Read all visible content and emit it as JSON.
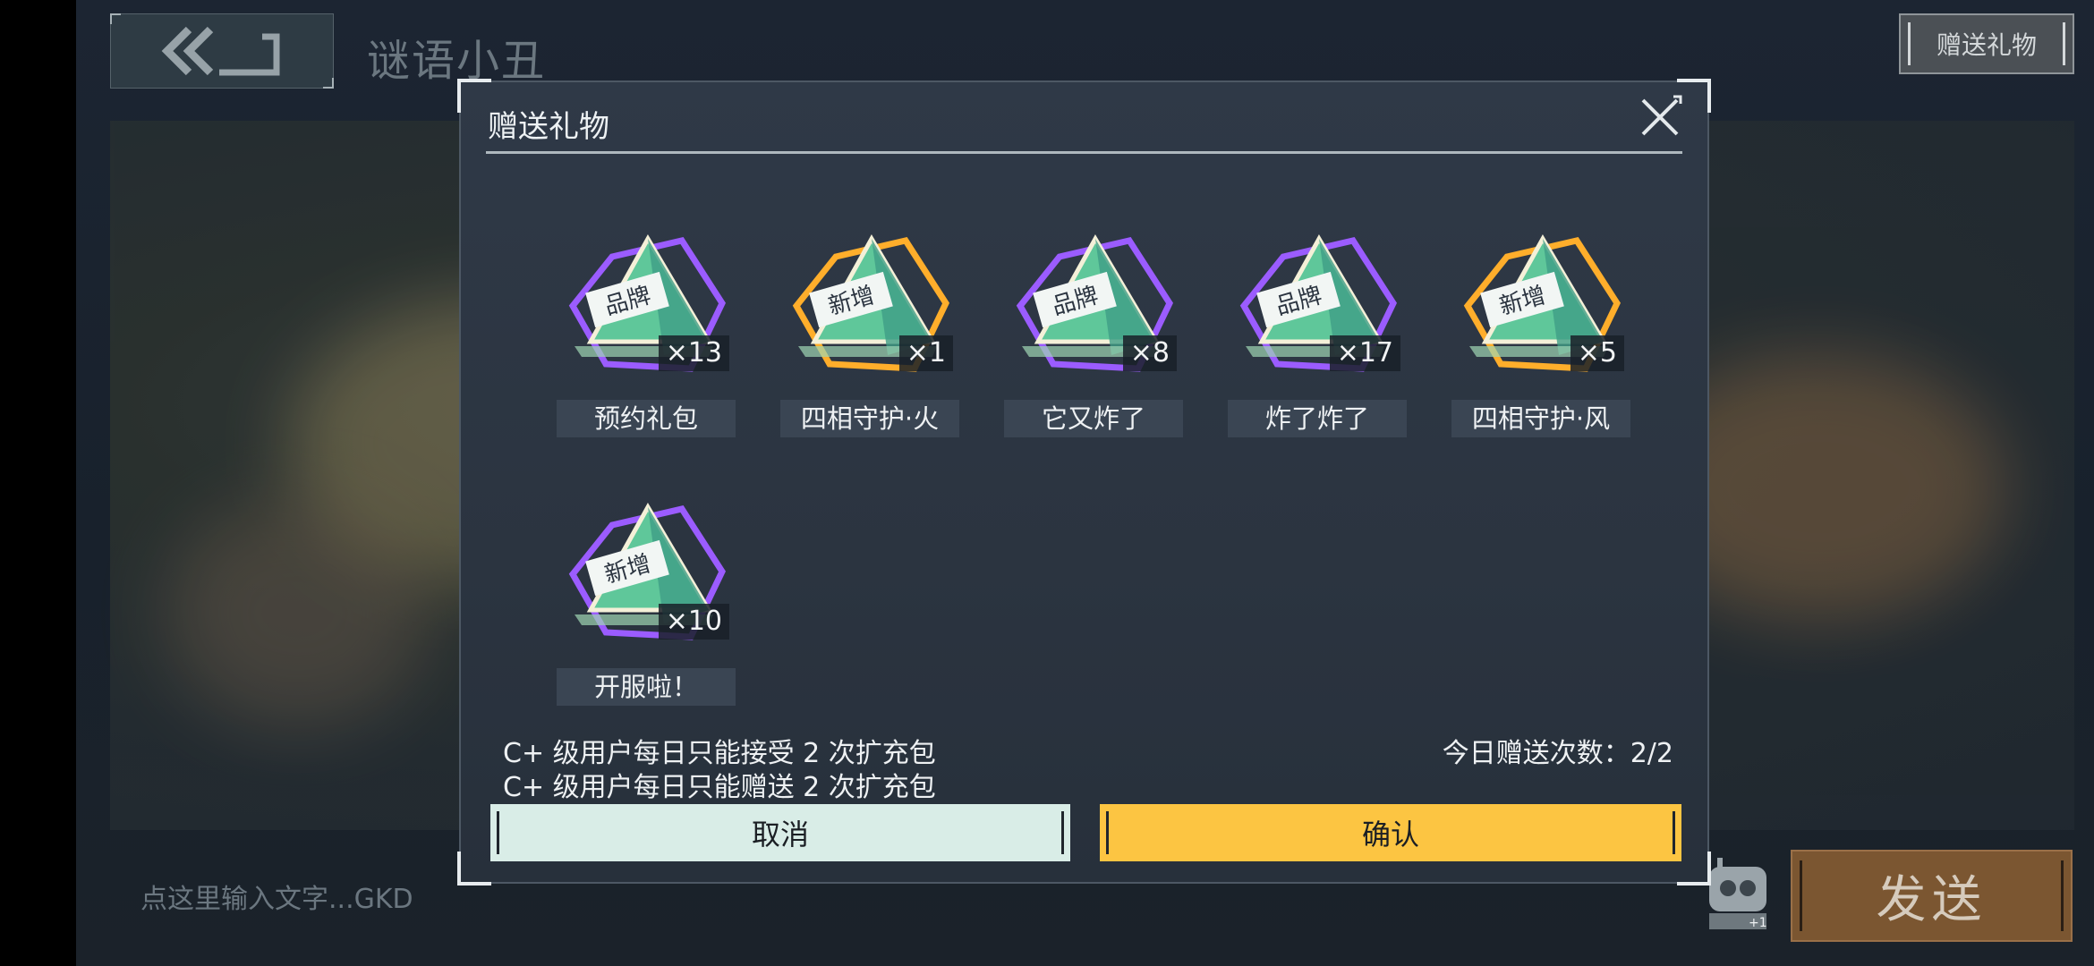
{
  "header": {
    "title": "谜语小丑",
    "gift_button": "赠送礼物"
  },
  "chat_input": {
    "placeholder": "点这里输入文字...GKD",
    "send_label": "发送",
    "emoji_badge": "+1"
  },
  "dialog": {
    "title": "赠送礼物",
    "gifts": [
      {
        "badge": "品牌",
        "count": "×13",
        "label": "预约礼包",
        "frame": "purple"
      },
      {
        "badge": "新增",
        "count": "×1",
        "label": "四相守护·火",
        "frame": "orange"
      },
      {
        "badge": "品牌",
        "count": "×8",
        "label": "它又炸了",
        "frame": "purple"
      },
      {
        "badge": "品牌",
        "count": "×17",
        "label": "炸了炸了",
        "frame": "purple"
      },
      {
        "badge": "新增",
        "count": "×5",
        "label": "四相守护·风",
        "frame": "orange"
      },
      {
        "badge": "新增",
        "count": "×10",
        "label": "开服啦！",
        "frame": "purple"
      }
    ],
    "rule_receive": "C+ 级用户每日只能接受 2 次扩充包",
    "rule_send": "C+ 级用户每日只能赠送 2 次扩充包",
    "daily_count": "今日赠送次数：2/2",
    "cancel_label": "取消",
    "confirm_label": "确认"
  },
  "colors": {
    "confirm": "#fcc542",
    "cancel": "#d9ede7",
    "send": "#7b5631",
    "purple_frame": "#9b5cff",
    "orange_frame": "#ffae2b"
  }
}
